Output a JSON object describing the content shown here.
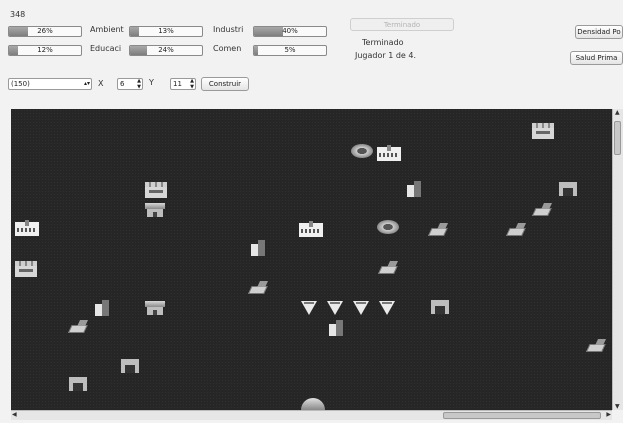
{
  "stats": {
    "row1": {
      "first": {
        "value_text": "26%",
        "level": 0.26
      },
      "ambient": {
        "label": "Ambient",
        "value_text": "13%",
        "level": 0.13
      },
      "industrial": {
        "label": "Industri",
        "value_text": "40%",
        "level": 0.4
      }
    },
    "row2": {
      "first": {
        "value_text": "12%",
        "level": 0.12
      },
      "education": {
        "label": "Educaci",
        "value_text": "24%",
        "level": 0.24
      },
      "commerce": {
        "label": "Comen",
        "value_text": "5%",
        "level": 0.05
      }
    },
    "top_number": "348"
  },
  "turn": {
    "finished_button": "Terminado",
    "status_line1": "Terminado",
    "status_line2": "Jugador 1 de 4."
  },
  "right_buttons": {
    "density": "Densidad Po",
    "health": "Salud Prima"
  },
  "build": {
    "type_select": "(150)",
    "x_label": "X",
    "x_value": "6",
    "y_label": "Y",
    "y_value": "11",
    "construct_button": "Construir"
  },
  "map": {
    "icons": [
      "factory-icon",
      "house-icon",
      "tower-icon",
      "road-icon",
      "hospital-icon",
      "stadium-icon",
      "shop-icon",
      "cone-icon",
      "dome-icon"
    ]
  }
}
